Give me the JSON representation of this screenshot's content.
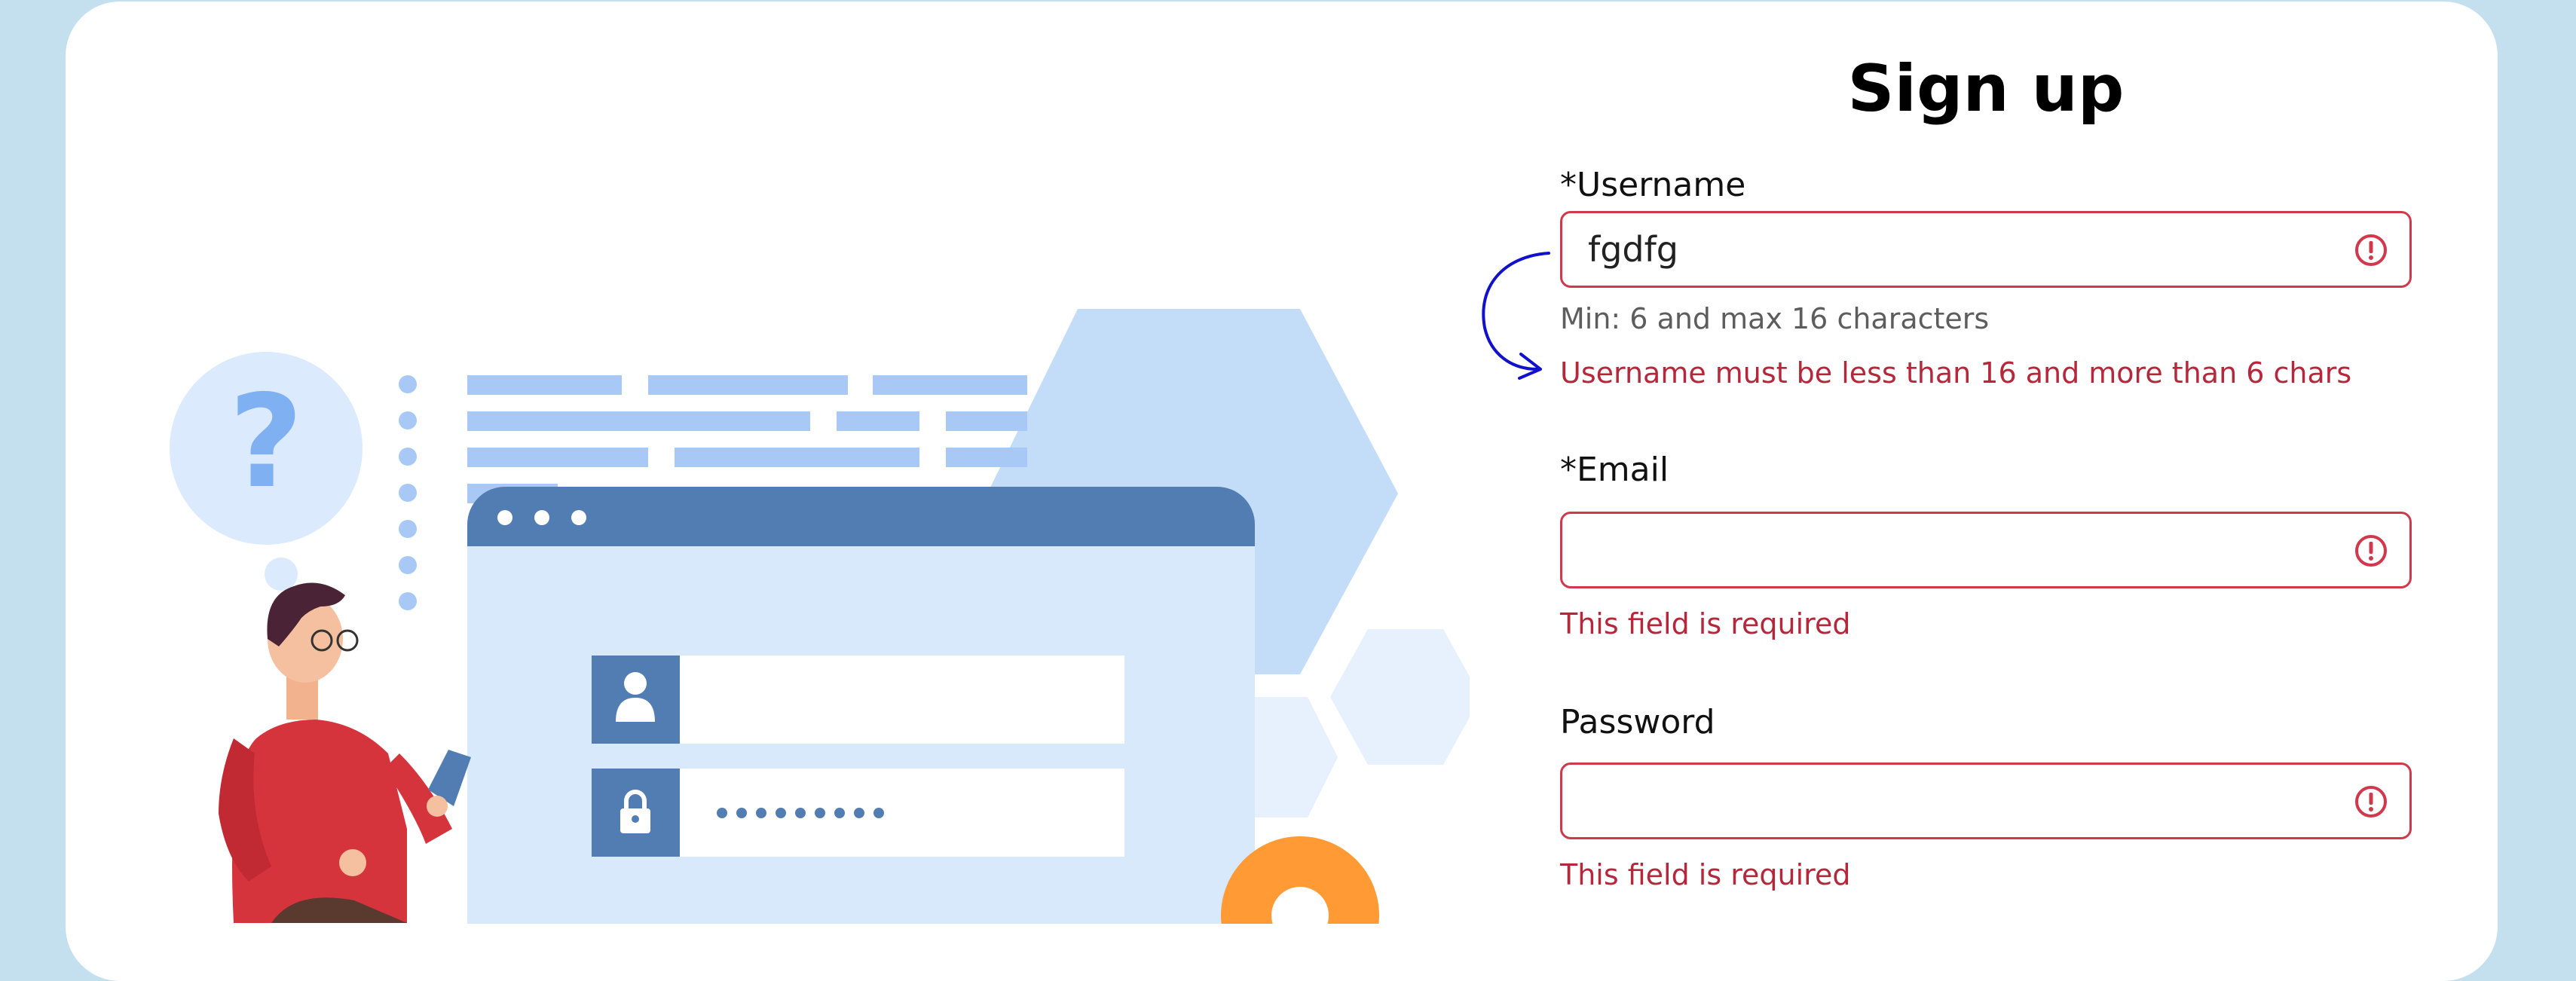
{
  "form": {
    "title": "Sign up",
    "username": {
      "label": "*Username",
      "value": "fgdfg",
      "help": "Min: 6 and max 16 characters",
      "error": "Username must be less than 16 and more than 6 chars"
    },
    "email": {
      "label": "*Email",
      "value": "",
      "error": "This field is required"
    },
    "password": {
      "label": "Password",
      "value": "",
      "error": "This field is required"
    }
  },
  "icons": {
    "error": "exclamation-circle-icon",
    "question": "question-mark-icon",
    "user": "user-icon",
    "lock": "lock-icon"
  },
  "colors": {
    "page_background": "#c4dfee",
    "error_border": "#d1384b",
    "error_text": "#b5283b",
    "annotation": "#1111cc",
    "illustration_primary": "#517db3",
    "illustration_light": "#d8e9fb"
  }
}
